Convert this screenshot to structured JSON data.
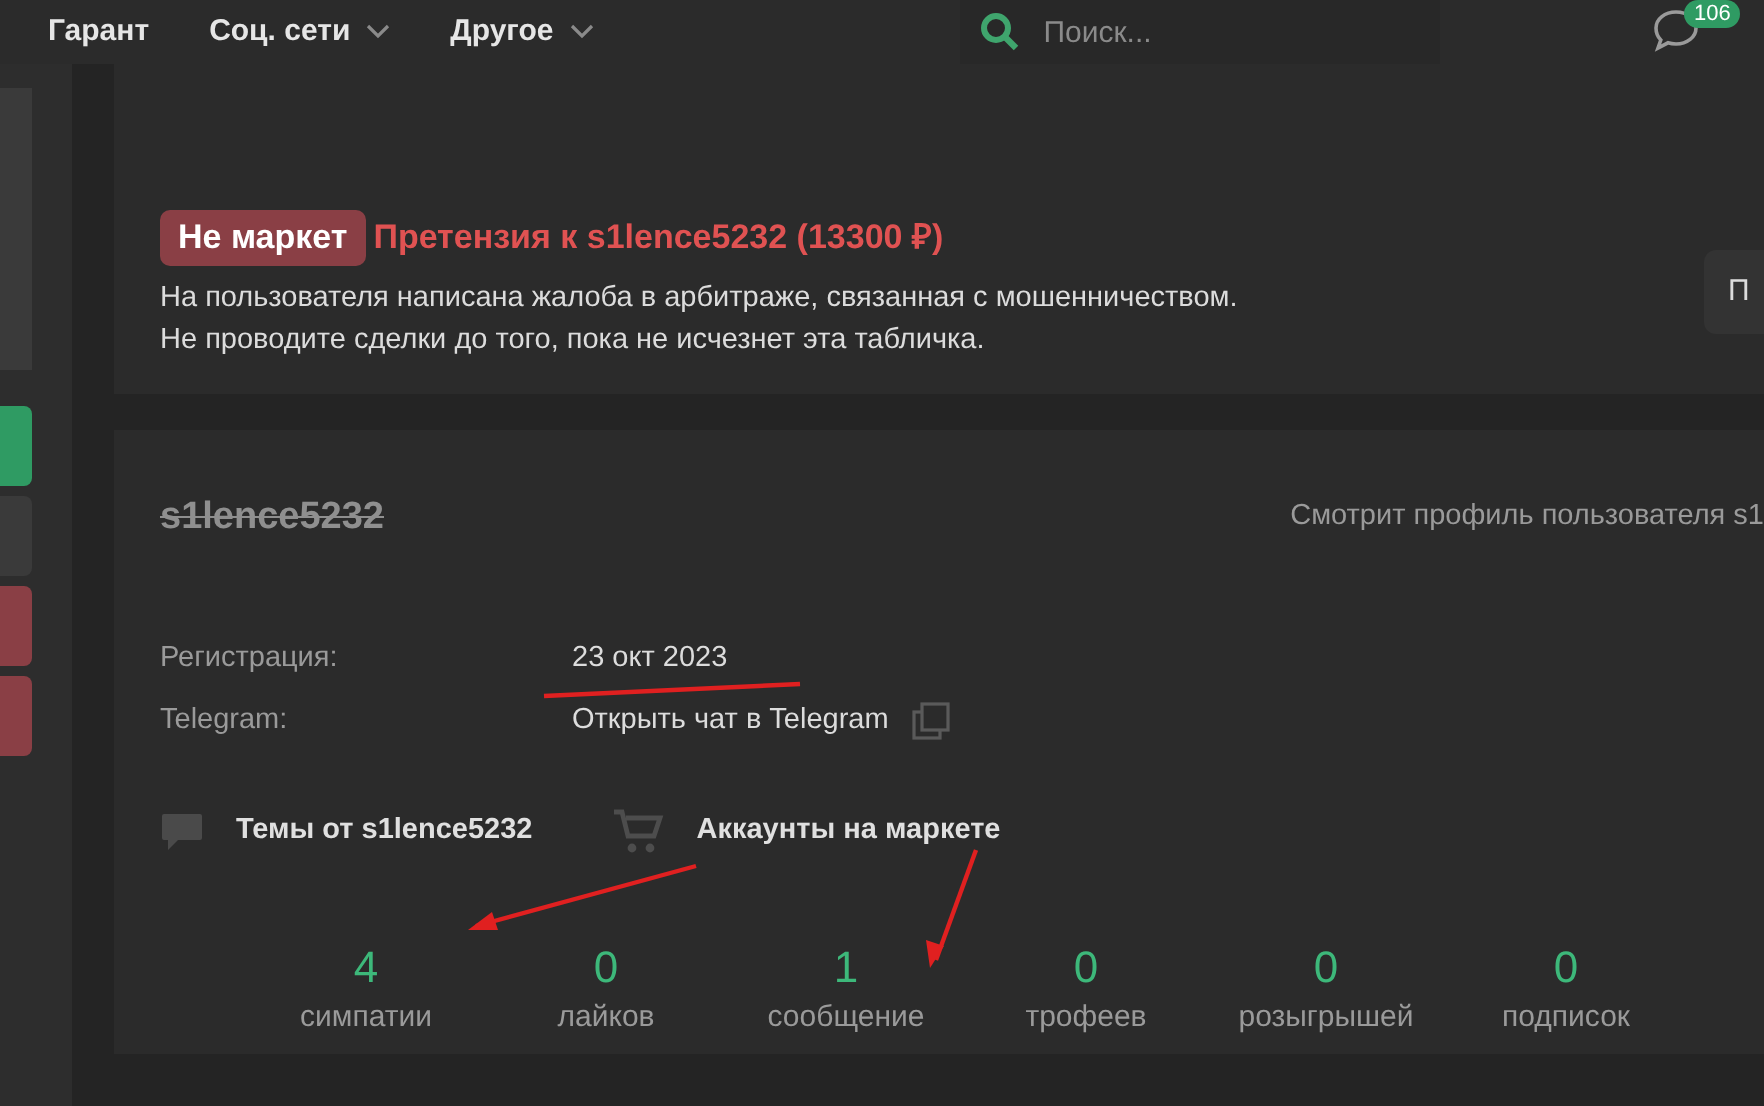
{
  "nav": {
    "items": [
      {
        "label": "Гарант",
        "dropdown": false
      },
      {
        "label": "Соц. сети",
        "dropdown": true
      },
      {
        "label": "Другое",
        "dropdown": true
      }
    ],
    "search": {
      "placeholder": "Поиск..."
    },
    "messages_badge": "106"
  },
  "warning": {
    "tag": "Не маркет",
    "title": "Претензия к s1lence5232 (13300 ₽)",
    "lines": [
      "На пользователя написана жалоба в арбитраже, связанная с мошенничеством.",
      "Не проводите сделки до того, пока не исчезнет эта табличка."
    ],
    "button": "П"
  },
  "profile": {
    "username": "s1lence5232",
    "banned": true,
    "viewing": "Смотрит профиль пользователя s1",
    "fields": [
      {
        "label": "Регистрация:",
        "value": "23 окт 2023",
        "copy": false
      },
      {
        "label": "Telegram:",
        "value": "Открыть чат в Telegram",
        "copy": true
      }
    ],
    "links": [
      {
        "kind": "topics",
        "label": "Темы от s1lence5232"
      },
      {
        "kind": "market",
        "label": "Аккаунты на маркете"
      }
    ],
    "counters": [
      {
        "value": "4",
        "label": "симпатии"
      },
      {
        "value": "0",
        "label": "лайков"
      },
      {
        "value": "1",
        "label": "сообщение"
      },
      {
        "value": "0",
        "label": "трофеев"
      },
      {
        "value": "0",
        "label": "розыгрышей"
      },
      {
        "value": "0",
        "label": "подписок"
      }
    ]
  }
}
